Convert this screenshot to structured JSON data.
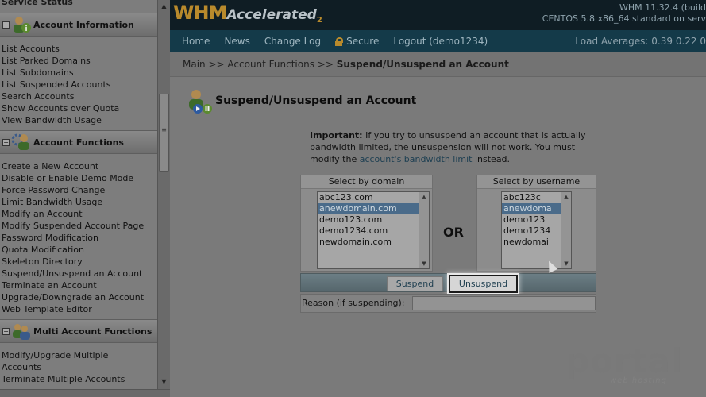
{
  "sidebar": {
    "top_item": "Service Status",
    "sections": [
      {
        "title": "Account Information",
        "icon": "user-info-icon",
        "items": [
          "List Accounts",
          "List Parked Domains",
          "List Subdomains",
          "List Suspended Accounts",
          "Search Accounts",
          "Show Accounts over Quota",
          "View Bandwidth Usage"
        ]
      },
      {
        "title": "Account Functions",
        "icon": "user-gear-icon",
        "items": [
          "Create a New Account",
          "Disable or Enable Demo Mode",
          "Force Password Change",
          "Limit Bandwidth Usage",
          "Modify an Account",
          "Modify Suspended Account Page",
          "Password Modification",
          "Quota Modification",
          "Skeleton Directory",
          "Suspend/Unsuspend an Account",
          "Terminate an Account",
          "Upgrade/Downgrade an Account",
          "Web Template Editor"
        ]
      },
      {
        "title": "Multi Account Functions",
        "icon": "multi-user-icon",
        "items": [
          "Modify/Upgrade Multiple",
          "Accounts",
          "Terminate Multiple Accounts"
        ]
      }
    ],
    "toggle_symbol": "⊟"
  },
  "header": {
    "logo_whm": "WHM",
    "logo_accelerated": "Accelerated",
    "logo_two": "2",
    "version": "WHM 11.32.4 (build",
    "os": "CENTOS 5.8 x86_64 standard on serv"
  },
  "nav": {
    "home": "Home",
    "news": "News",
    "changelog": "Change Log",
    "secure": "Secure",
    "logout": "Logout (demo1234)",
    "load_averages": "Load Averages: 0.39 0.22 0"
  },
  "breadcrumb": {
    "main": "Main",
    "sep": " >> ",
    "section": "Account Functions",
    "current": "Suspend/Unsuspend an Account"
  },
  "page": {
    "title": "Suspend/Unsuspend an Account",
    "important_label": "Important:",
    "important_text": " If you try to unsuspend an account that is actually bandwidth limited, the unsuspension will not work. You must modify the ",
    "important_link": "account's bandwidth limit",
    "important_tail": " instead."
  },
  "domain_panel": {
    "header": "Select by domain",
    "options": [
      "abc123.com",
      "anewdomain.com",
      "demo123.com",
      "demo1234.com",
      "newdomain.com"
    ],
    "selected_index": 1
  },
  "username_panel": {
    "header": "Select by username",
    "options": [
      "abc123c",
      "anewdoma",
      "demo123",
      "demo1234",
      "newdomai"
    ],
    "selected_index": 1
  },
  "or_label": "OR",
  "buttons": {
    "suspend": "Suspend",
    "unsuspend": "Unsuspend"
  },
  "reason": {
    "label": "Reason (if suspending):",
    "value": ""
  },
  "watermark": {
    "text": "portal",
    "sub": "web hosting"
  },
  "colors": {
    "header_bg": "#0f1d24",
    "nav_bg": "#143a49",
    "logo_gold": "#b88a2c",
    "selected_option": "#4a6b8a"
  }
}
